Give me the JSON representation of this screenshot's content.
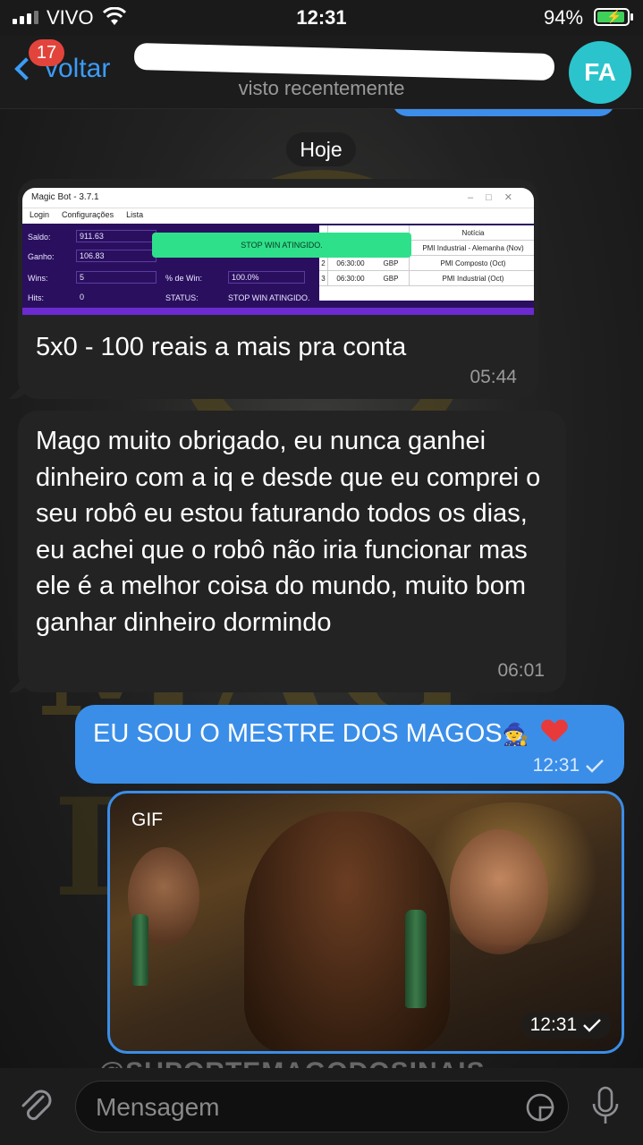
{
  "status_bar": {
    "carrier": "VIVO",
    "time": "12:31",
    "battery": "94%",
    "battery_level": 0.94
  },
  "header": {
    "back_label": "voltar",
    "unread_count": "17",
    "status": "visto recentemente",
    "avatar_initials": "FA"
  },
  "date_separator": "Hoje",
  "messages": [
    {
      "direction": "incoming",
      "screenshot": {
        "window_title": "Magic Bot - 3.7.1",
        "menu": [
          "Login",
          "Configurações",
          "Lista"
        ],
        "fields": {
          "saldo_label": "Saldo:",
          "saldo_value": "911.63",
          "ganho_label": "Ganho:",
          "ganho_value": "106.83",
          "wins_label": "Wins:",
          "wins_value": "5",
          "hits_label": "Hits:",
          "hits_value": "0",
          "win_pct_label": "% de Win:",
          "win_pct_value": "100.0%",
          "status_label": "STATUS:",
          "status_value": "STOP WIN ATINGIDO."
        },
        "banner": "STOP WIN ATINGIDO.",
        "table": {
          "header": "Notícia",
          "rows": [
            {
              "n": "",
              "time": "",
              "currency": "",
              "news": "PMI Industrial - Alemanha (Nov)"
            },
            {
              "n": "2",
              "time": "06:30:00",
              "currency": "GBP",
              "news": "PMI Composto (Oct)"
            },
            {
              "n": "3",
              "time": "06:30:00",
              "currency": "GBP",
              "news": "PMI Industrial (Oct)"
            }
          ]
        }
      },
      "text": "5x0 - 100 reais a mais pra conta",
      "time": "05:44"
    },
    {
      "direction": "incoming",
      "text": "Mago muito obrigado, eu nunca ganhei dinheiro com a iq e desde que eu comprei o seu robô eu estou faturando todos os dias, eu achei que o robô não iria funcionar mas ele é a melhor coisa do mundo, muito bom ganhar dinheiro dormindo",
      "time": "06:01"
    },
    {
      "direction": "outgoing",
      "text": "EU SOU O MESTRE DOS MAGOS",
      "emoji": "🧙",
      "time": "12:31",
      "status_icon": "checkmark-icon"
    },
    {
      "direction": "outgoing",
      "media_label": "GIF",
      "time": "12:31",
      "status_icon": "checkmark-icon"
    }
  ],
  "watermark": "@SUPORTEMAGODOSINAIS",
  "composer": {
    "placeholder": "Mensagem"
  },
  "colors": {
    "accent": "#3b9cf5",
    "outgoing_bubble": "#3a8ee8",
    "incoming_bubble": "#232323",
    "badge": "#e2443c",
    "avatar": "#2bc4cc"
  }
}
